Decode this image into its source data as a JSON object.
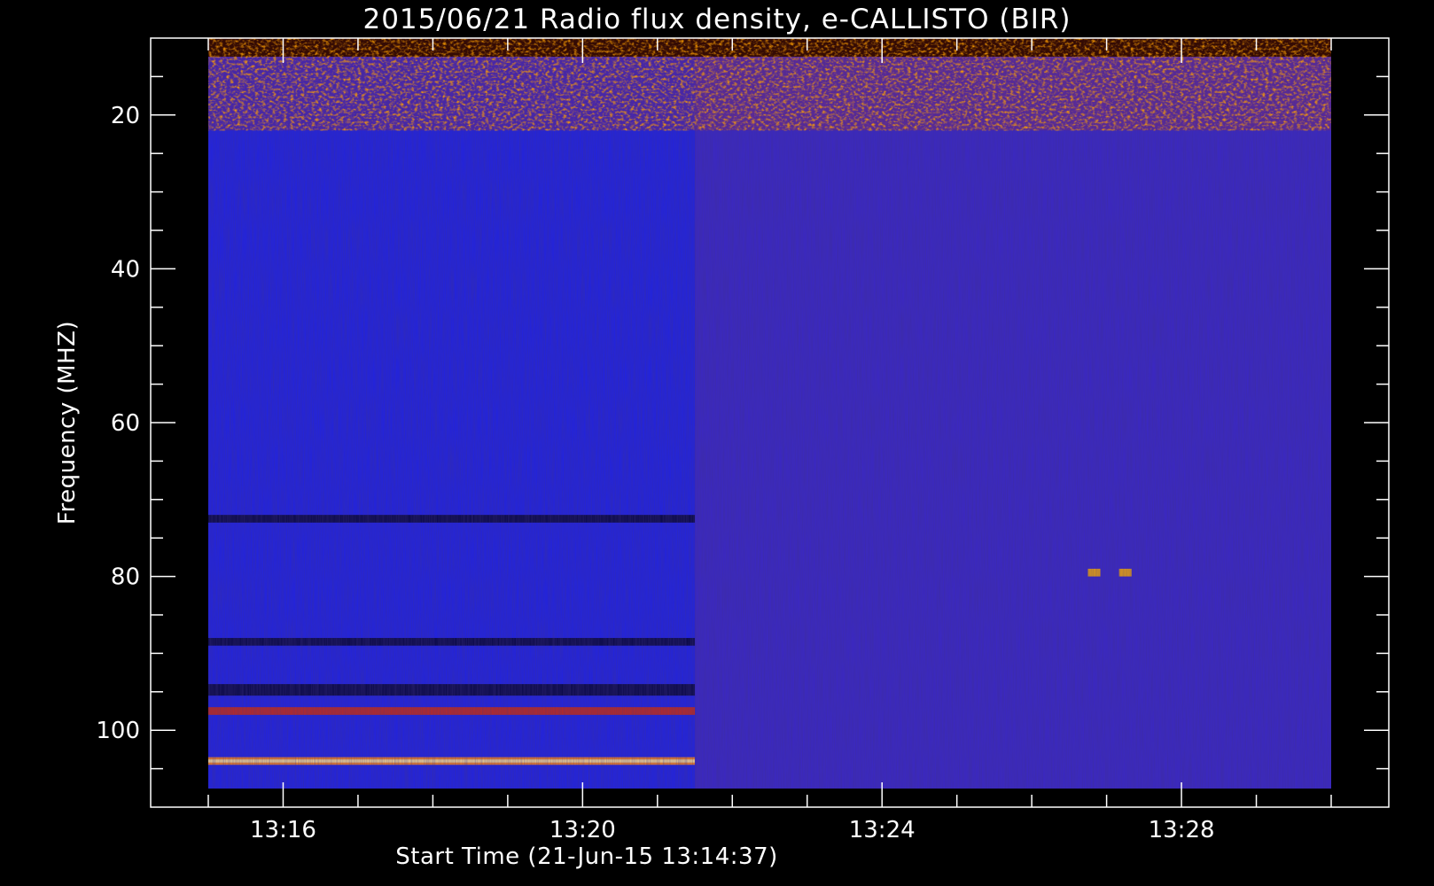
{
  "chart_data": {
    "type": "heatmap",
    "title": "2015/06/21  Radio flux density, e-CALLISTO (BIR)",
    "xlabel": "Start Time (21-Jun-15 13:14:37)",
    "ylabel": "Frequency (MHZ)",
    "x_start": "13:14:37",
    "x_range": [
      "13:15:00",
      "13:30:00"
    ],
    "y_range_mhz": [
      10,
      105
    ],
    "y_inverted": true,
    "x_ticks": [
      "13:16",
      "13:20",
      "13:24",
      "13:28"
    ],
    "y_ticks": [
      20,
      40,
      60,
      80,
      100
    ],
    "colormap": [
      "#000000",
      "#0a0a6e",
      "#1818e8",
      "#5a2aa8",
      "#a01818",
      "#ff3a00",
      "#ffc000",
      "#ffffe0"
    ],
    "features": [
      {
        "name": "interference band",
        "freq_mhz": [
          10,
          22
        ],
        "time": [
          "13:15",
          "13:30"
        ],
        "intensity": "high"
      },
      {
        "name": "strong band",
        "freq_mhz": [
          103.5,
          104.5
        ],
        "time": [
          "13:15",
          "13:21:30"
        ],
        "intensity": "very high"
      },
      {
        "name": "band",
        "freq_mhz": [
          97,
          98
        ],
        "time": [
          "13:15",
          "13:21:30"
        ],
        "intensity": "high"
      },
      {
        "name": "dark band",
        "freq_mhz": [
          72,
          73
        ],
        "time": [
          "13:15",
          "13:21:30"
        ],
        "intensity": "low"
      },
      {
        "name": "dark band",
        "freq_mhz": [
          88,
          89
        ],
        "time": [
          "13:15",
          "13:21:30"
        ],
        "intensity": "low"
      },
      {
        "name": "dark band",
        "freq_mhz": [
          94,
          95.5
        ],
        "time": [
          "13:15",
          "13:21:30"
        ],
        "intensity": "low"
      },
      {
        "name": "spot",
        "freq_mhz": [
          79,
          80
        ],
        "time": [
          "13:26:45",
          "13:26:55"
        ],
        "intensity": "high"
      },
      {
        "name": "spot",
        "freq_mhz": [
          79,
          80
        ],
        "time": [
          "13:27:10",
          "13:27:20"
        ],
        "intensity": "high"
      }
    ],
    "background_change_time": "13:21:30"
  }
}
